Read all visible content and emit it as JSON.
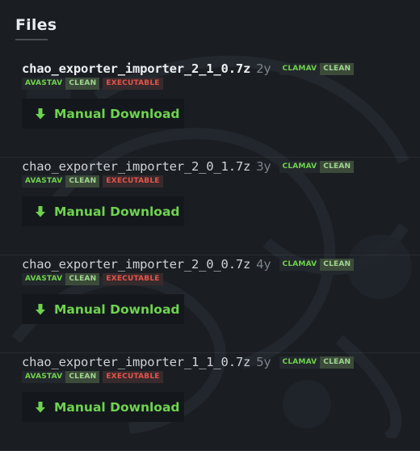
{
  "section": {
    "title": "Files"
  },
  "colors": {
    "accent_green": "#6ed34e",
    "executable_red": "#e5534b",
    "clean_text": "#9fd68e",
    "background": "#1a1e23"
  },
  "download_icon": "arrow-down-icon",
  "files": [
    {
      "name": "chao_exporter_importer_2_1_0.7z",
      "age": "2y",
      "scans": [
        {
          "scanner": "CLAMAV",
          "result": "CLEAN"
        },
        {
          "scanner": "AVASTAV",
          "result": "CLEAN"
        }
      ],
      "flag": "EXECUTABLE",
      "download_label": "Manual Download",
      "name_color": "#eef0f2"
    },
    {
      "name": "chao_exporter_importer_2_0_1.7z",
      "age": "3y",
      "scans": [
        {
          "scanner": "CLAMAV",
          "result": "CLEAN"
        },
        {
          "scanner": "AVASTAV",
          "result": "CLEAN"
        }
      ],
      "flag": "EXECUTABLE",
      "download_label": "Manual Download",
      "name_color": "#cfd3d7"
    },
    {
      "name": "chao_exporter_importer_2_0_0.7z",
      "age": "4y",
      "scans": [
        {
          "scanner": "CLAMAV",
          "result": "CLEAN"
        },
        {
          "scanner": "AVASTAV",
          "result": "CLEAN"
        }
      ],
      "flag": "EXECUTABLE",
      "download_label": "Manual Download",
      "name_color": "#cfd3d7"
    },
    {
      "name": "chao_exporter_importer_1_1_0.7z",
      "age": "5y",
      "scans": [
        {
          "scanner": "CLAMAV",
          "result": "CLEAN"
        },
        {
          "scanner": "AVASTAV",
          "result": "CLEAN"
        }
      ],
      "flag": "EXECUTABLE",
      "download_label": "Manual Download",
      "name_color": "#cfd3d7"
    }
  ]
}
